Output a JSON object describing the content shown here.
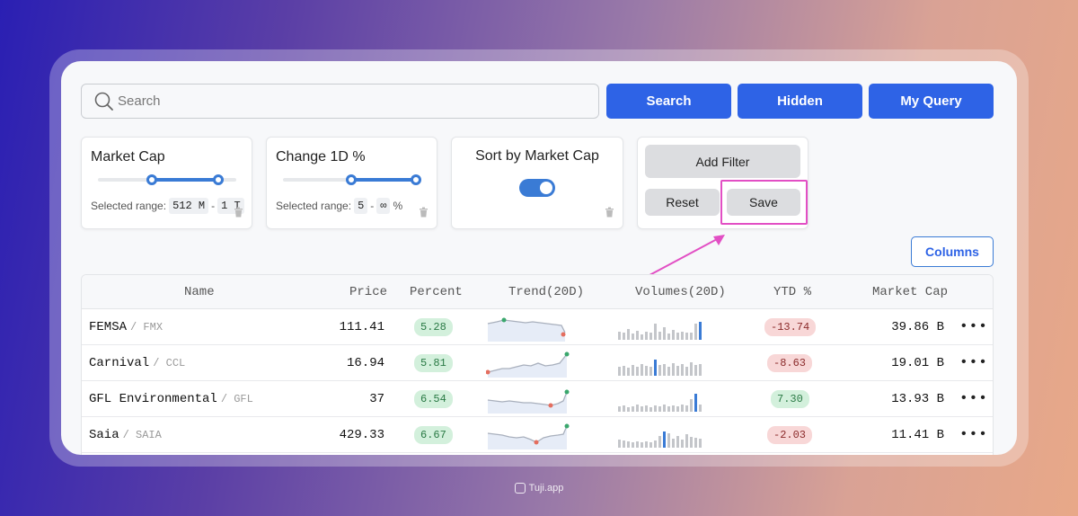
{
  "search": {
    "placeholder": "Search"
  },
  "actions": [
    {
      "label": "Search"
    },
    {
      "label": "Hidden"
    },
    {
      "label": "My Query"
    }
  ],
  "filters": {
    "market_cap": {
      "title": "Market Cap",
      "range_label": "Selected range:",
      "min": "512 M",
      "sep": "-",
      "max": "1 T"
    },
    "change_1d": {
      "title": "Change 1D %",
      "range_label": "Selected range:",
      "min": "5",
      "sep": "-",
      "max": "∞",
      "unit": "%"
    },
    "sort": {
      "title": "Sort by Market Cap",
      "enabled": true
    },
    "panel": {
      "add_label": "Add Filter",
      "reset_label": "Reset",
      "save_label": "Save"
    }
  },
  "columns_button": "Columns",
  "table": {
    "headers": [
      "Name",
      "Price",
      "Percent",
      "Trend(20D)",
      "Volumes(20D)",
      "YTD %",
      "Market Cap"
    ],
    "rows": [
      {
        "name": "FEMSA",
        "ticker": "/ FMX",
        "price": "111.41",
        "percent": "5.28",
        "ytd": "-13.74",
        "ytd_sign": "neg",
        "mcap": "39.86 B",
        "menu": "•••"
      },
      {
        "name": "Carnival",
        "ticker": "/ CCL",
        "price": "16.94",
        "percent": "5.81",
        "ytd": "-8.63",
        "ytd_sign": "neg",
        "mcap": "19.01 B",
        "menu": "•••"
      },
      {
        "name": "GFL Environmental",
        "ticker": "/ GFL",
        "price": "37",
        "percent": "6.54",
        "ytd": "7.30",
        "ytd_sign": "pos",
        "mcap": "13.93 B",
        "menu": "•••"
      },
      {
        "name": "Saia",
        "ticker": "/ SAIA",
        "price": "429.33",
        "percent": "6.67",
        "ytd": "-2.03",
        "ytd_sign": "neg",
        "mcap": "11.41 B",
        "menu": "•••"
      }
    ]
  },
  "footer": {
    "brand": "Tuji.app"
  },
  "colors": {
    "primary": "#2e63e6",
    "highlight": "#e24fc4",
    "positive_bg": "#d3f0dc",
    "negative_bg": "#f8d7d7"
  }
}
